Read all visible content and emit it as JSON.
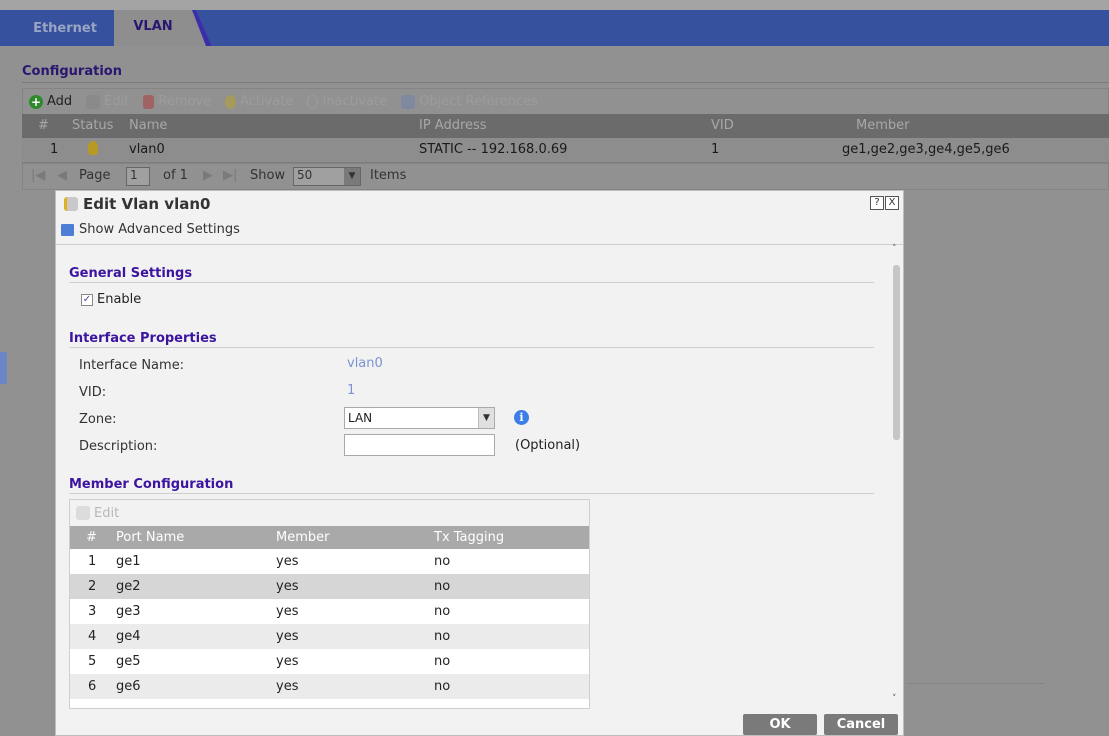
{
  "tabs": [
    {
      "label": "Ethernet"
    },
    {
      "label": "VLAN"
    }
  ],
  "configuration": {
    "title": "Configuration",
    "toolbar": {
      "add": "Add",
      "edit": "Edit",
      "remove": "Remove",
      "activate": "Activate",
      "inactivate": "Inactivate",
      "object_references": "Object References"
    },
    "columns": {
      "num": "#",
      "status": "Status",
      "name": "Name",
      "ip": "IP Address",
      "vid": "VID",
      "member": "Member"
    },
    "rows": [
      {
        "num": "1",
        "status": "active",
        "name": "vlan0",
        "ip": "STATIC -- 192.168.0.69",
        "vid": "1",
        "member": "ge1,ge2,ge3,ge4,ge5,ge6"
      }
    ],
    "pager": {
      "page_label": "Page",
      "page": "1",
      "of": "of 1",
      "show": "Show",
      "per_page": "50",
      "items": "Items"
    }
  },
  "dialog": {
    "title": "Edit Vlan vlan0",
    "help": "?",
    "close": "X",
    "advanced": "Show Advanced Settings",
    "general": {
      "title": "General Settings",
      "enable_label": "Enable",
      "enabled": true
    },
    "iface": {
      "title": "Interface Properties",
      "name_label": "Interface Name:",
      "name": "vlan0",
      "vid_label": "VID:",
      "vid": "1",
      "zone_label": "Zone:",
      "zone": "LAN",
      "desc_label": "Description:",
      "desc": "",
      "optional": "(Optional)"
    },
    "member": {
      "title": "Member Configuration",
      "edit": "Edit",
      "columns": {
        "num": "#",
        "port": "Port Name",
        "member": "Member",
        "tx": "Tx Tagging"
      },
      "rows": [
        {
          "num": "1",
          "port": "ge1",
          "member": "yes",
          "tx": "no"
        },
        {
          "num": "2",
          "port": "ge2",
          "member": "yes",
          "tx": "no"
        },
        {
          "num": "3",
          "port": "ge3",
          "member": "yes",
          "tx": "no"
        },
        {
          "num": "4",
          "port": "ge4",
          "member": "yes",
          "tx": "no"
        },
        {
          "num": "5",
          "port": "ge5",
          "member": "yes",
          "tx": "no"
        },
        {
          "num": "6",
          "port": "ge6",
          "member": "yes",
          "tx": "no"
        }
      ]
    },
    "ok": "OK",
    "cancel": "Cancel"
  }
}
